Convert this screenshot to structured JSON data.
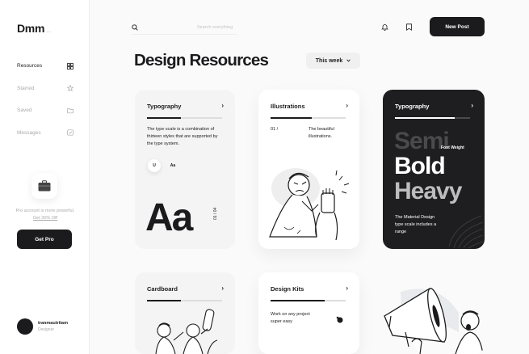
{
  "app": {
    "logo": "Dmm",
    "logo_suffix": "..."
  },
  "sidebar": {
    "items": [
      {
        "label": "Resources",
        "icon": "grid-icon",
        "active": true
      },
      {
        "label": "Starred",
        "icon": "star-icon",
        "active": false
      },
      {
        "label": "Saved",
        "icon": "folder-icon",
        "active": false
      },
      {
        "label": "Messages",
        "icon": "message-icon",
        "active": false
      }
    ],
    "promo": {
      "text": "Pro account is more powerful.",
      "link": "Get 30% Off",
      "button": "Get Pro"
    },
    "user": {
      "name": "tranmautritam",
      "role": "Designer"
    }
  },
  "header": {
    "search_placeholder": "Search everything",
    "new_post": "New Post"
  },
  "main": {
    "title": "Design Resources",
    "filter": "This week"
  },
  "cards": {
    "typography": {
      "title": "Typography",
      "description": "The type scale is a combination of thirteen styles that are supported by the type system.",
      "btn1": "U",
      "btn2": "Aa",
      "sample": "Aa",
      "page": "01 / 04"
    },
    "illustrations": {
      "title": "Illustrations",
      "page": "01 /",
      "description": "The beautiful illustrations."
    },
    "typography_dark": {
      "title": "Typography",
      "label": "Font Weight",
      "w1": "Semi",
      "w2": "Bold",
      "w3": "Heavy",
      "description": "The Material Design type scale includes a range"
    },
    "cardboard": {
      "title": "Cardboard"
    },
    "design_kits": {
      "title": "Design Kits",
      "description": "Work on any project super easy"
    }
  },
  "colors": {
    "accent": "#1b1b1d",
    "muted": "#aaaaaa",
    "dark_card": "#1e1e20"
  }
}
